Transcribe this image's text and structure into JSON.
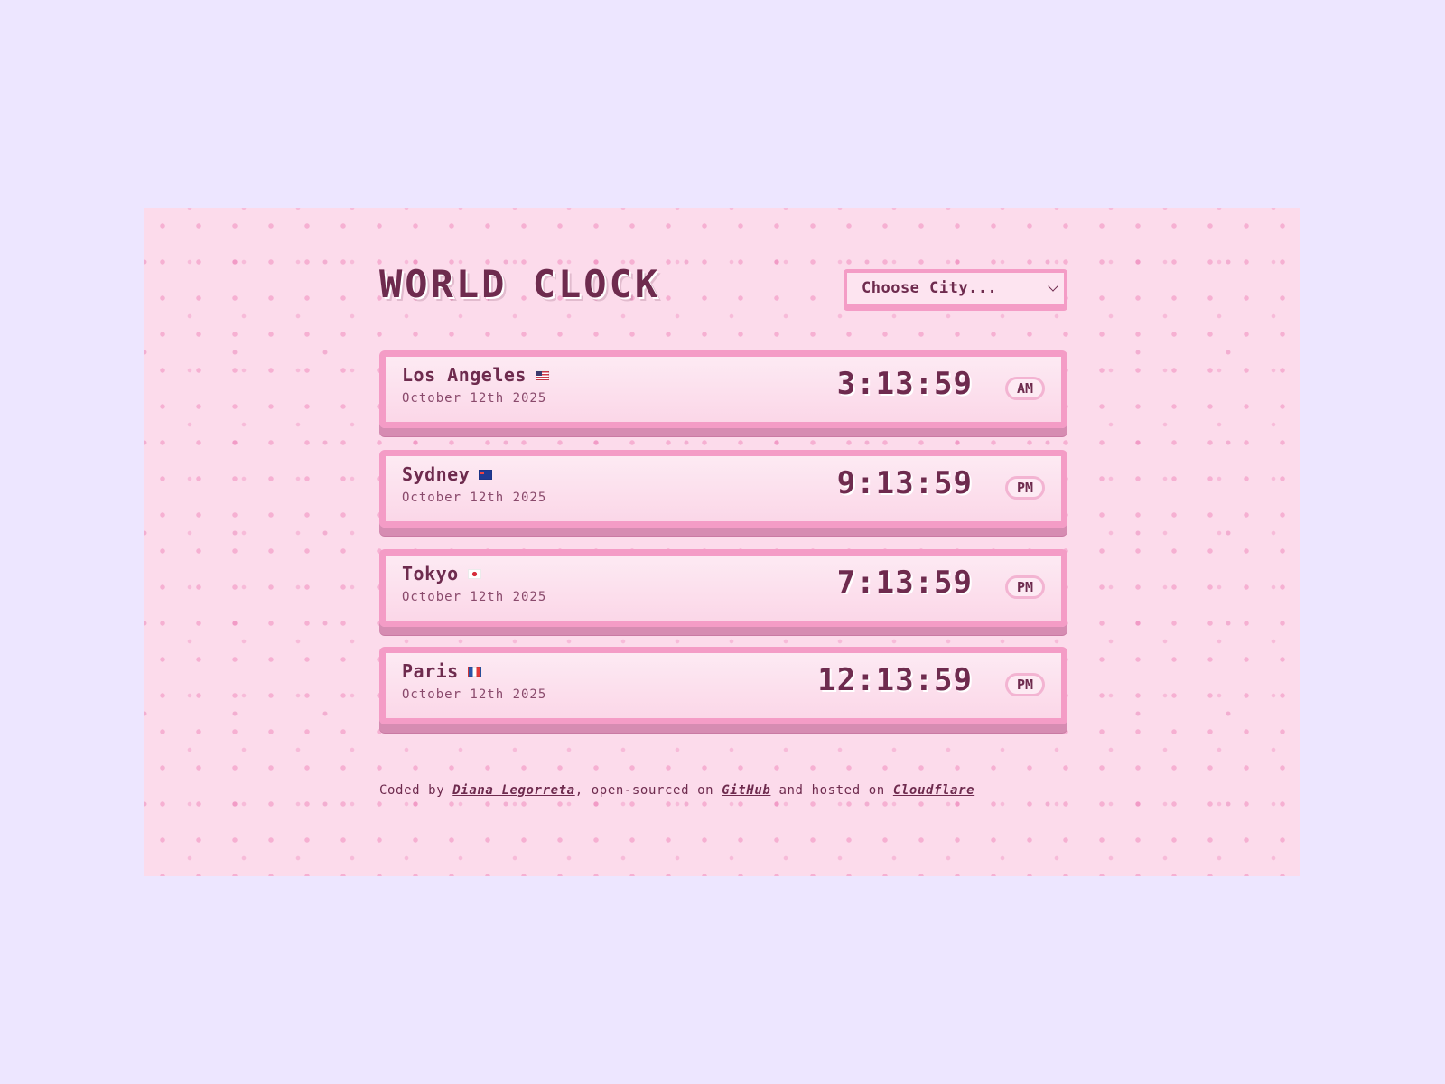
{
  "header": {
    "title": "WORLD CLOCK",
    "city_select": {
      "selected": "Choose City..."
    }
  },
  "clocks": [
    {
      "city": "Los Angeles",
      "flag": "us-flag-icon",
      "date": "October 12th 2025",
      "time": "3:13:59",
      "meridiem": "AM"
    },
    {
      "city": "Sydney",
      "flag": "au-flag-icon",
      "date": "October 12th 2025",
      "time": "9:13:59",
      "meridiem": "PM"
    },
    {
      "city": "Tokyo",
      "flag": "jp-flag-icon",
      "date": "October 12th 2025",
      "time": "7:13:59",
      "meridiem": "PM"
    },
    {
      "city": "Paris",
      "flag": "fr-flag-icon",
      "date": "October 12th 2025",
      "time": "12:13:59",
      "meridiem": "PM"
    }
  ],
  "footer": {
    "prefix": "Coded by",
    "author_link": "Diana Legorreta",
    "middle": ", open-sourced on",
    "github_link": "GitHub",
    "and_hosted": "and hosted on",
    "cloudflare_link": "Cloudflare"
  },
  "colors": {
    "page_background": "#ede6ff",
    "panel_background": "#fcdbeb",
    "accent_pink": "#f49cc6",
    "text_plum": "#6e2b4e"
  }
}
